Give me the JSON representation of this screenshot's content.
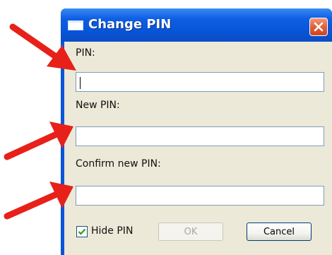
{
  "window": {
    "title": "Change PIN",
    "icon": "window-icon",
    "close_icon": "close-icon"
  },
  "form": {
    "pin_label": "PIN:",
    "pin_value": "",
    "new_pin_label": "New PIN:",
    "new_pin_value": "",
    "confirm_label": "Confirm new PIN:",
    "confirm_value": ""
  },
  "options": {
    "hide_pin_label": "Hide PIN",
    "hide_pin_checked": true
  },
  "buttons": {
    "ok_label": "OK",
    "ok_enabled": false,
    "cancel_label": "Cancel"
  },
  "annotations": {
    "arrow_color": "#e8201a",
    "arrow_icon": "red-arrow-icon"
  }
}
